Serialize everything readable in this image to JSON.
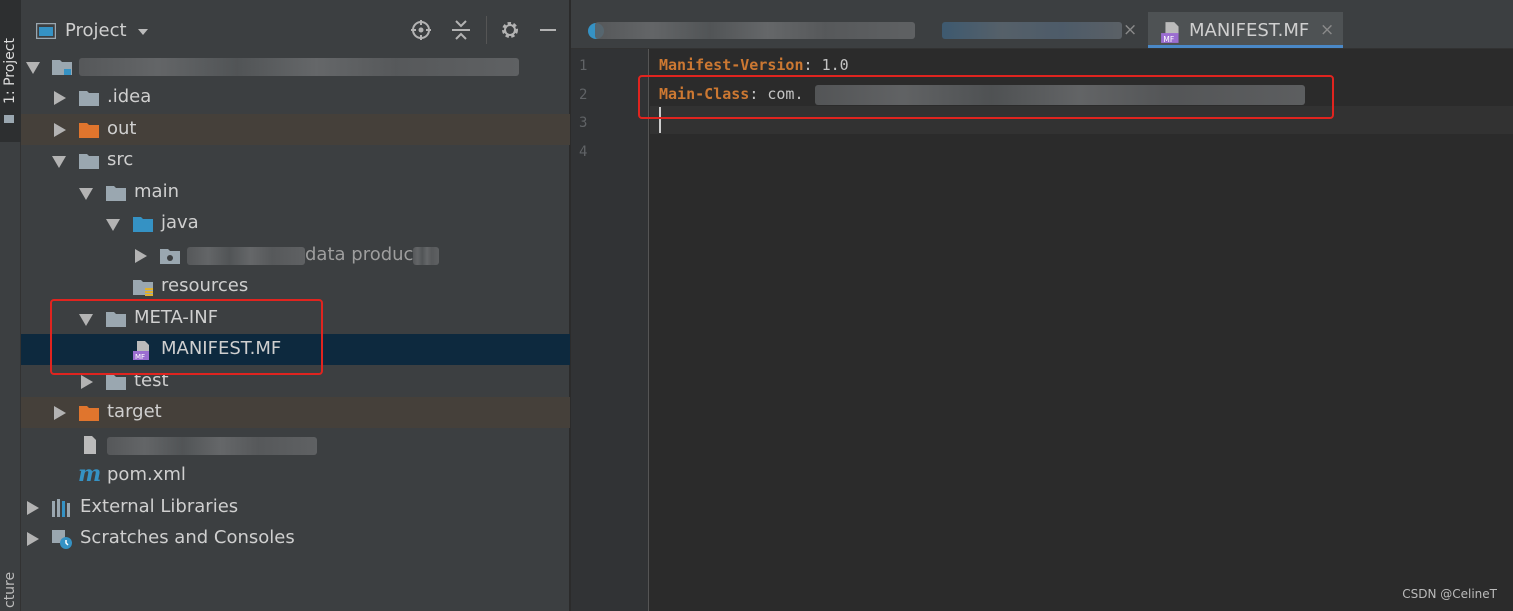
{
  "tool_strip": {
    "project_tab": "1: Project",
    "structure_tab": "cture"
  },
  "project_panel": {
    "title": "Project",
    "tree": [
      {
        "label": "",
        "redacted": true
      },
      {
        "label": ".idea"
      },
      {
        "label": "out"
      },
      {
        "label": "src"
      },
      {
        "label": "main"
      },
      {
        "label": "java"
      },
      {
        "label": "data produc",
        "redacted": true
      },
      {
        "label": "resources"
      },
      {
        "label": "META-INF"
      },
      {
        "label": "MANIFEST.MF"
      },
      {
        "label": "test"
      },
      {
        "label": "target"
      },
      {
        "label": "",
        "redacted": true
      },
      {
        "label": "pom.xml"
      },
      {
        "label": "External Libraries"
      },
      {
        "label": "Scratches and Consoles"
      }
    ]
  },
  "editor": {
    "tabs": [
      {
        "label": "",
        "redacted": true
      },
      {
        "label": "",
        "redacted": true
      },
      {
        "label": "MANIFEST.MF",
        "active": true
      }
    ],
    "close_glyph": "×",
    "line_numbers": [
      "1",
      "2",
      "3",
      "4"
    ],
    "lines": [
      {
        "key": "Manifest-Version",
        "sep": ": ",
        "value": "1.0"
      },
      {
        "key": "Main-Class",
        "sep": ": ",
        "value": "com."
      }
    ]
  },
  "icons": {
    "locate": "crosshair-icon",
    "collapse": "collapse-all-icon",
    "settings": "gear-icon",
    "hide": "minimize-icon",
    "maven": "m"
  },
  "watermark": "CSDN @CelineT",
  "colors": {
    "keyword": "#cc7832",
    "selection": "#0d293e",
    "excluded": "#45403a",
    "highlight": "#e0241f"
  }
}
